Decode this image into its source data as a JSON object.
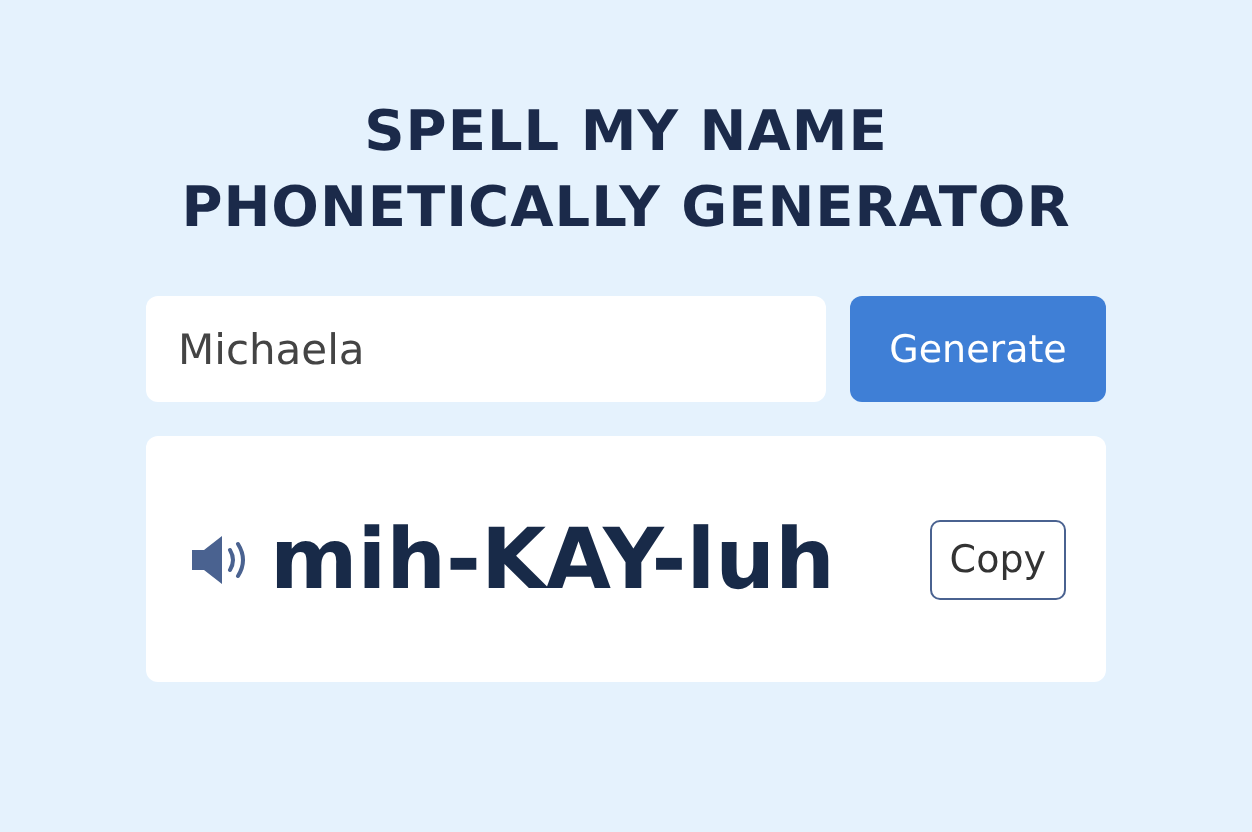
{
  "title": "SPELL MY NAME PHONETICALLY GENERATOR",
  "name_field": {
    "value": "Michaela"
  },
  "generate_button": {
    "label": "Generate"
  },
  "result": {
    "pronunciation": "mih-KAY-luh",
    "copy_button": {
      "label": "Copy"
    }
  }
}
